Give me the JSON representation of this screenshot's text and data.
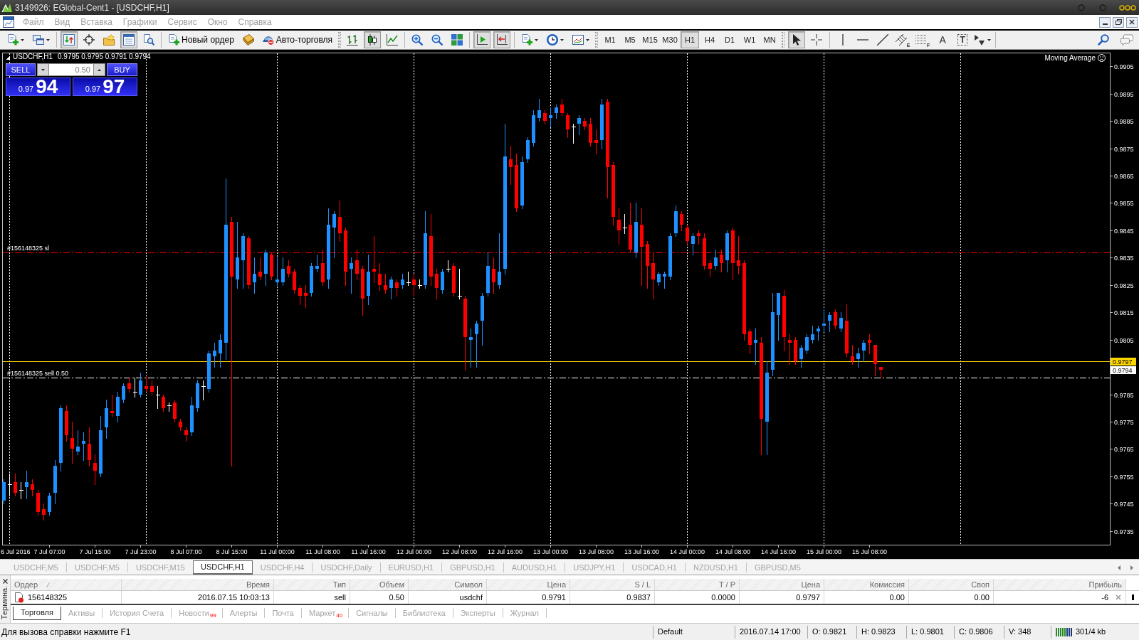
{
  "window": {
    "title": "3149926: EGlobal-Cent1 - [USDCHF,H1]"
  },
  "menu": [
    "Файл",
    "Вид",
    "Вставка",
    "Графики",
    "Сервис",
    "Окно",
    "Справка"
  ],
  "toolbar": {
    "groups": [
      [
        {
          "kind": "newchart",
          "pressed": false
        },
        {
          "kind": "profiles",
          "pressed": false
        }
      ],
      [
        {
          "kind": "market",
          "pressed": true
        },
        {
          "kind": "navigator",
          "pressed": false
        },
        {
          "kind": "favorites",
          "pressed": false
        },
        {
          "kind": "terminal",
          "pressed": true
        },
        {
          "kind": "tester",
          "pressed": false
        }
      ],
      [
        {
          "kind": "order",
          "label": "Новый ордер",
          "pressed": false
        },
        {
          "kind": "editor",
          "pressed": false
        },
        {
          "kind": "autotrade",
          "label": "Авто-торговля",
          "pressed": false
        }
      ],
      [
        {
          "kind": "bars",
          "pressed": false
        },
        {
          "kind": "candles",
          "pressed": true
        },
        {
          "kind": "line",
          "pressed": false
        }
      ],
      [
        {
          "kind": "zoomin",
          "pressed": false
        },
        {
          "kind": "zoomout",
          "pressed": false
        },
        {
          "kind": "tile",
          "pressed": false
        }
      ],
      [
        {
          "kind": "autoscroll",
          "pressed": true
        },
        {
          "kind": "shift",
          "pressed": true
        }
      ],
      [
        {
          "kind": "indicators",
          "pressed": false
        },
        {
          "kind": "periods",
          "pressed": false
        },
        {
          "kind": "templates",
          "pressed": false
        }
      ]
    ],
    "timeframes": [
      {
        "label": "M1",
        "selected": false
      },
      {
        "label": "M5",
        "selected": false
      },
      {
        "label": "M15",
        "selected": false
      },
      {
        "label": "M30",
        "selected": false
      },
      {
        "label": "H1",
        "selected": true
      },
      {
        "label": "H4",
        "selected": false
      },
      {
        "label": "D1",
        "selected": false
      },
      {
        "label": "W1",
        "selected": false
      },
      {
        "label": "MN",
        "selected": false
      }
    ],
    "tools": [
      [
        {
          "kind": "cursor",
          "pressed": true
        },
        {
          "kind": "crosshair",
          "pressed": false
        }
      ],
      [
        {
          "kind": "vline",
          "pressed": false
        },
        {
          "kind": "hline",
          "pressed": false
        },
        {
          "kind": "trend",
          "pressed": false
        },
        {
          "kind": "channel",
          "label": "E",
          "pressed": false
        },
        {
          "kind": "fibo",
          "label": "F",
          "pressed": false
        },
        {
          "kind": "text",
          "label": "A",
          "pressed": false
        },
        {
          "kind": "textlabel",
          "label": "T",
          "pressed": false
        },
        {
          "kind": "arrows",
          "pressed": false
        }
      ]
    ],
    "right": [
      {
        "kind": "search"
      },
      {
        "kind": "chat"
      }
    ]
  },
  "chart": {
    "trade_panel": {
      "sell": {
        "label": "SELL",
        "price_prefix": "0.97",
        "price_big": "94"
      },
      "buy": {
        "label": "BUY",
        "price_prefix": "0.97",
        "price_big": "97"
      },
      "volume": "0.50"
    },
    "expert": {
      "name": "Moving Average",
      "active": false
    },
    "bid_label": "0.9794",
    "chart_data": [
      {
        "type": "candlestick",
        "title": "USDCHF,H1",
        "subtitle": "0.9795 0.9795 0.9791 0.9794",
        "annotations": [
          "6 Jul 2016"
        ],
        "categories": [
          null,
          null,
          null,
          null,
          null,
          null,
          null,
          null,
          "7 Jul 07:00",
          null,
          null,
          null,
          null,
          null,
          null,
          null,
          "7 Jul 15:00",
          null,
          null,
          null,
          null,
          null,
          null,
          null,
          "7 Jul 23:00",
          null,
          null,
          null,
          null,
          null,
          null,
          null,
          "8 Jul 07:00",
          null,
          null,
          null,
          null,
          null,
          null,
          null,
          "8 Jul 15:00",
          null,
          null,
          null,
          null,
          null,
          null,
          null,
          "11 Jul 00:00",
          null,
          null,
          null,
          null,
          null,
          null,
          null,
          "11 Jul 08:00",
          null,
          null,
          null,
          null,
          null,
          null,
          null,
          "11 Jul 16:00",
          null,
          null,
          null,
          null,
          null,
          null,
          null,
          "12 Jul 00:00",
          null,
          null,
          null,
          null,
          null,
          null,
          null,
          "12 Jul 08:00",
          null,
          null,
          null,
          null,
          null,
          null,
          null,
          "12 Jul 16:00",
          null,
          null,
          null,
          null,
          null,
          null,
          null,
          "13 Jul 00:00",
          null,
          null,
          null,
          null,
          null,
          null,
          null,
          "13 Jul 08:00",
          null,
          null,
          null,
          null,
          null,
          null,
          null,
          "13 Jul 16:00",
          null,
          null,
          null,
          null,
          null,
          null,
          null,
          "14 Jul 00:00",
          null,
          null,
          null,
          null,
          null,
          null,
          null,
          "14 Jul 08:00",
          null,
          null,
          null,
          null,
          null,
          null,
          null,
          "14 Jul 16:00",
          null,
          null,
          null,
          null,
          null,
          null,
          null,
          "15 Jul 00:00",
          null,
          null,
          null,
          null,
          null,
          null,
          null,
          "15 Jul 08:00",
          null,
          null,
          null,
          null,
          null,
          null,
          null,
          null,
          null,
          null,
          null,
          null,
          null,
          null,
          null,
          null,
          null,
          null,
          null,
          null,
          null,
          null,
          null,
          null,
          null,
          null,
          null,
          null,
          null,
          null,
          null,
          null,
          null,
          null,
          null,
          null,
          null,
          null,
          null,
          null,
          null,
          null
        ],
        "ohlc": [
          [
            0.9746,
            0.9754,
            0.9745,
            0.9753
          ],
          [
            0.9752,
            0.9756,
            0.9748,
            0.9752
          ],
          [
            0.9753,
            0.9756,
            0.9748,
            0.9749
          ],
          [
            0.975,
            0.9753,
            0.9747,
            0.975
          ],
          [
            0.9751,
            0.9757,
            0.9747,
            0.9753
          ],
          [
            0.9752,
            0.9754,
            0.9748,
            0.975
          ],
          [
            0.9749,
            0.975,
            0.9741,
            0.9742
          ],
          [
            0.9743,
            0.9745,
            0.9739,
            0.9741
          ],
          [
            0.9742,
            0.9749,
            0.9741,
            0.9748
          ],
          [
            0.9749,
            0.9761,
            0.9745,
            0.9759
          ],
          [
            0.976,
            0.9781,
            0.9757,
            0.978
          ],
          [
            0.9779,
            0.9781,
            0.9768,
            0.977
          ],
          [
            0.9769,
            0.9775,
            0.976,
            0.9765
          ],
          [
            0.9764,
            0.9772,
            0.9763,
            0.9766
          ],
          [
            0.9767,
            0.9771,
            0.9761,
            0.9768
          ],
          [
            0.9767,
            0.9773,
            0.9759,
            0.9761
          ],
          [
            0.976,
            0.9763,
            0.9752,
            0.9757
          ],
          [
            0.9756,
            0.9777,
            0.9755,
            0.9772
          ],
          [
            0.9773,
            0.9783,
            0.9769,
            0.978
          ],
          [
            0.9779,
            0.9785,
            0.9777,
            0.9778
          ],
          [
            0.9777,
            0.9786,
            0.9775,
            0.9784
          ],
          [
            0.9783,
            0.9789,
            0.9782,
            0.9788
          ],
          [
            0.9789,
            0.9791,
            0.9786,
            0.9787
          ],
          [
            0.9786,
            0.9791,
            0.9784,
            0.9786
          ],
          [
            0.9785,
            0.9793,
            0.9784,
            0.979
          ],
          [
            0.9788,
            0.9792,
            0.9786,
            0.9787
          ],
          [
            0.9788,
            0.979,
            0.9785,
            0.9786
          ],
          [
            0.9785,
            0.9788,
            0.978,
            0.9785
          ],
          [
            0.9784,
            0.9785,
            0.9779,
            0.978
          ],
          [
            0.9781,
            0.9782,
            0.9779,
            0.9781
          ],
          [
            0.9782,
            0.9783,
            0.9775,
            0.9776
          ],
          [
            0.9775,
            0.9776,
            0.9772,
            0.9773
          ],
          [
            0.9772,
            0.9773,
            0.9768,
            0.977
          ],
          [
            0.9771,
            0.9784,
            0.977,
            0.9781
          ],
          [
            0.978,
            0.979,
            0.9779,
            0.9789
          ],
          [
            0.9788,
            0.979,
            0.9783,
            0.9788
          ],
          [
            0.9787,
            0.9801,
            0.9786,
            0.98
          ],
          [
            0.9799,
            0.9804,
            0.9795,
            0.9801
          ],
          [
            0.98,
            0.9807,
            0.9795,
            0.9805
          ],
          [
            0.9804,
            0.9864,
            0.9798,
            0.9847
          ],
          [
            0.9848,
            0.985,
            0.9759,
            0.9828
          ],
          [
            0.9827,
            0.9848,
            0.9824,
            0.9835
          ],
          [
            0.9834,
            0.9844,
            0.9824,
            0.9843
          ],
          [
            0.9842,
            0.9843,
            0.9824,
            0.9825
          ],
          [
            0.9826,
            0.9835,
            0.9822,
            0.9829
          ],
          [
            0.983,
            0.9835,
            0.9827,
            0.9828
          ],
          [
            0.9829,
            0.9838,
            0.9825,
            0.9837
          ],
          [
            0.9836,
            0.9837,
            0.9827,
            0.9828
          ],
          [
            0.9826,
            0.9835,
            0.9825,
            0.9827
          ],
          [
            0.9826,
            0.9835,
            0.9825,
            0.9831
          ],
          [
            0.9832,
            0.9834,
            0.9828,
            0.9829
          ],
          [
            0.983,
            0.9831,
            0.9822,
            0.9823
          ],
          [
            0.9824,
            0.9825,
            0.9818,
            0.9821
          ],
          [
            0.9822,
            0.9825,
            0.9817,
            0.9821
          ],
          [
            0.9822,
            0.9833,
            0.9821,
            0.9832
          ],
          [
            0.9831,
            0.9836,
            0.983,
            0.9832
          ],
          [
            0.9833,
            0.9838,
            0.9825,
            0.9826
          ],
          [
            0.9827,
            0.9853,
            0.9824,
            0.9847
          ],
          [
            0.9846,
            0.9852,
            0.9835,
            0.9851
          ],
          [
            0.985,
            0.9856,
            0.9841,
            0.9844
          ],
          [
            0.9845,
            0.9846,
            0.9825,
            0.983
          ],
          [
            0.9831,
            0.9835,
            0.9822,
            0.9833
          ],
          [
            0.9834,
            0.9838,
            0.9827,
            0.9829
          ],
          [
            0.9831,
            0.9832,
            0.9814,
            0.982
          ],
          [
            0.9821,
            0.9836,
            0.9818,
            0.983
          ],
          [
            0.9831,
            0.9843,
            0.9826,
            0.983
          ],
          [
            0.9829,
            0.9833,
            0.9823,
            0.9825
          ],
          [
            0.9825,
            0.9829,
            0.9822,
            0.9823
          ],
          [
            0.9824,
            0.9828,
            0.982,
            0.9827
          ],
          [
            0.9826,
            0.9827,
            0.9821,
            0.9824
          ],
          [
            0.9825,
            0.9829,
            0.9824,
            0.9827
          ],
          [
            0.9826,
            0.983,
            0.9825,
            0.9826
          ],
          [
            0.9827,
            0.9829,
            0.9821,
            0.9825
          ],
          [
            0.9825,
            0.9827,
            0.9824,
            0.9825
          ],
          [
            0.9825,
            0.9852,
            0.9824,
            0.9844
          ],
          [
            0.9843,
            0.9851,
            0.9825,
            0.9828
          ],
          [
            0.9829,
            0.9831,
            0.982,
            0.9824
          ],
          [
            0.9823,
            0.9831,
            0.9822,
            0.983
          ],
          [
            0.9831,
            0.9834,
            0.983,
            0.9831
          ],
          [
            0.9832,
            0.9833,
            0.9821,
            0.9822
          ],
          [
            0.9821,
            0.9831,
            0.982,
            0.9821
          ],
          [
            0.982,
            0.9821,
            0.9794,
            0.9806
          ],
          [
            0.9805,
            0.9809,
            0.9795,
            0.9806
          ],
          [
            0.9807,
            0.9812,
            0.9795,
            0.9811
          ],
          [
            0.9812,
            0.9822,
            0.9803,
            0.9821
          ],
          [
            0.9822,
            0.9837,
            0.9821,
            0.9832
          ],
          [
            0.9831,
            0.9835,
            0.9822,
            0.9826
          ],
          [
            0.9825,
            0.9844,
            0.9824,
            0.983
          ],
          [
            0.9831,
            0.9884,
            0.9829,
            0.9872
          ],
          [
            0.9871,
            0.9876,
            0.9862,
            0.9868
          ],
          [
            0.9869,
            0.9873,
            0.9852,
            0.9853
          ],
          [
            0.9854,
            0.9872,
            0.9853,
            0.987
          ],
          [
            0.9871,
            0.9879,
            0.987,
            0.9878
          ],
          [
            0.9877,
            0.9889,
            0.9876,
            0.9887
          ],
          [
            0.9886,
            0.9893,
            0.9885,
            0.9889
          ],
          [
            0.9888,
            0.9889,
            0.9884,
            0.9885
          ],
          [
            0.9886,
            0.989,
            0.9883,
            0.9887
          ],
          [
            0.9888,
            0.9891,
            0.9886,
            0.989
          ],
          [
            0.9891,
            0.9893,
            0.9887,
            0.9888
          ],
          [
            0.9887,
            0.9888,
            0.9879,
            0.9882
          ],
          [
            0.9883,
            0.9884,
            0.9877,
            0.9883
          ],
          [
            0.9884,
            0.9887,
            0.988,
            0.9886
          ],
          [
            0.9885,
            0.9886,
            0.9882,
            0.9883
          ],
          [
            0.9884,
            0.9886,
            0.9876,
            0.9877
          ],
          [
            0.9878,
            0.9882,
            0.9873,
            0.9877
          ],
          [
            0.9878,
            0.9893,
            0.9875,
            0.9891
          ],
          [
            0.9892,
            0.9893,
            0.9857,
            0.9868
          ],
          [
            0.9869,
            0.987,
            0.9847,
            0.985
          ],
          [
            0.9849,
            0.9853,
            0.984,
            0.9845
          ],
          [
            0.9846,
            0.9851,
            0.9844,
            0.9846
          ],
          [
            0.9847,
            0.9855,
            0.9837,
            0.9838
          ],
          [
            0.9837,
            0.9855,
            0.9835,
            0.9848
          ],
          [
            0.9847,
            0.9853,
            0.9825,
            0.9839
          ],
          [
            0.984,
            0.9841,
            0.9824,
            0.9832
          ],
          [
            0.9833,
            0.9837,
            0.982,
            0.9827
          ],
          [
            0.9826,
            0.983,
            0.9825,
            0.9829
          ],
          [
            0.9828,
            0.983,
            0.9824,
            0.9829
          ],
          [
            0.9828,
            0.9844,
            0.9827,
            0.9843
          ],
          [
            0.9844,
            0.9854,
            0.9843,
            0.9852
          ],
          [
            0.9851,
            0.9852,
            0.9845,
            0.9847
          ],
          [
            0.9846,
            0.9847,
            0.984,
            0.9841
          ],
          [
            0.984,
            0.9844,
            0.9836,
            0.9843
          ],
          [
            0.9844,
            0.9845,
            0.984,
            0.9843
          ],
          [
            0.9842,
            0.9844,
            0.9831,
            0.9832
          ],
          [
            0.9833,
            0.9834,
            0.9828,
            0.9831
          ],
          [
            0.9832,
            0.9838,
            0.9831,
            0.9835
          ],
          [
            0.9836,
            0.9838,
            0.983,
            0.9833
          ],
          [
            0.9834,
            0.9845,
            0.983,
            0.9844
          ],
          [
            0.9845,
            0.9846,
            0.9827,
            0.9833
          ],
          [
            0.9834,
            0.9843,
            0.9829,
            0.9832
          ],
          [
            0.9833,
            0.9834,
            0.9805,
            0.9807
          ],
          [
            0.9808,
            0.9809,
            0.98,
            0.9803
          ],
          [
            0.9804,
            0.9809,
            0.9796,
            0.9805
          ],
          [
            0.9804,
            0.9806,
            0.9763,
            0.9776
          ],
          [
            0.9775,
            0.9797,
            0.9763,
            0.9793
          ],
          [
            0.9794,
            0.9822,
            0.9792,
            0.9815
          ],
          [
            0.9814,
            0.9822,
            0.9805,
            0.9822
          ],
          [
            0.9821,
            0.9823,
            0.9801,
            0.9806
          ],
          [
            0.9805,
            0.9807,
            0.9796,
            0.9804
          ],
          [
            0.9805,
            0.9806,
            0.9796,
            0.9797
          ],
          [
            0.9798,
            0.9803,
            0.9795,
            0.9802
          ],
          [
            0.9801,
            0.9807,
            0.98,
            0.9806
          ],
          [
            0.9805,
            0.981,
            0.9804,
            0.9807
          ],
          [
            0.9808,
            0.981,
            0.9805,
            0.9809
          ],
          [
            0.981,
            0.9816,
            0.9808,
            0.9811
          ],
          [
            0.9812,
            0.9815,
            0.9808,
            0.9814
          ],
          [
            0.9815,
            0.9816,
            0.9809,
            0.981
          ],
          [
            0.9809,
            0.9815,
            0.9808,
            0.9813
          ],
          [
            0.9812,
            0.9818,
            0.9799,
            0.98
          ],
          [
            0.9799,
            0.9803,
            0.9796,
            0.9797
          ],
          [
            0.9798,
            0.9802,
            0.9795,
            0.98
          ],
          [
            0.9801,
            0.9805,
            0.9797,
            0.9804
          ],
          [
            0.9805,
            0.9807,
            0.98,
            0.9804
          ],
          [
            0.9803,
            0.9803,
            0.9792,
            0.9796
          ],
          [
            0.9795,
            0.9795,
            0.9791,
            0.9794
          ],
          null,
          null,
          null,
          null,
          null,
          null,
          null,
          null,
          null,
          null,
          null,
          null,
          null,
          null,
          null,
          null,
          null,
          null,
          null,
          null,
          null,
          null,
          null,
          null,
          null,
          null,
          null,
          null,
          null,
          null,
          null,
          null,
          null,
          null,
          null,
          null,
          null,
          null,
          null,
          null
        ],
        "ylim": [
          0.973,
          0.991
        ],
        "yticks": [
          0.9735,
          0.9745,
          0.9755,
          0.9765,
          0.9775,
          0.9785,
          0.9805,
          0.9815,
          0.9825,
          0.9835,
          0.9845,
          0.9855,
          0.9865,
          0.9875,
          0.9885,
          0.9895,
          0.9905
        ],
        "ref_lines": [
          {
            "axis": "y",
            "value": 0.9837,
            "label": "#156148325 sl",
            "color": "#ff0000",
            "line_style": "dashdot"
          },
          {
            "axis": "y",
            "value": 0.9791,
            "label": "#156148325 sell 0.50",
            "color": "#ffffff",
            "line_style": "dashdot"
          },
          {
            "axis": "y",
            "value": 0.9797,
            "label": "0.9797",
            "color": "#ffd700",
            "line_style": "solid"
          }
        ]
      }
    ]
  },
  "chart_tabs": [
    {
      "label": "USDCHF,M5",
      "selected": false
    },
    {
      "label": "USDCHF,M5",
      "selected": false
    },
    {
      "label": "USDCHF,M15",
      "selected": false
    },
    {
      "label": "USDCHF,H1",
      "selected": true
    },
    {
      "label": "USDCHF,H4",
      "selected": false
    },
    {
      "label": "USDCHF,Daily",
      "selected": false
    },
    {
      "label": "EURUSD,H1",
      "selected": false
    },
    {
      "label": "GBPUSD,H1",
      "selected": false
    },
    {
      "label": "AUDUSD,H1",
      "selected": false
    },
    {
      "label": "USDJPY,H1",
      "selected": false
    },
    {
      "label": "USDCAD,H1",
      "selected": false
    },
    {
      "label": "NZDUSD,H1",
      "selected": false
    },
    {
      "label": "GBPUSD,M5",
      "selected": false
    }
  ],
  "terminal": {
    "title": "Термина.",
    "columns": [
      {
        "label": "Ордер",
        "sorted": true
      },
      {
        "label": "Время",
        "sorted": false
      },
      {
        "label": "Тип",
        "sorted": false
      },
      {
        "label": "Объем",
        "sorted": false
      },
      {
        "label": "Символ",
        "sorted": false
      },
      {
        "label": "Цена",
        "sorted": false
      },
      {
        "label": "S / L",
        "sorted": false
      },
      {
        "label": "T / P",
        "sorted": false
      },
      {
        "label": "Цена",
        "sorted": false
      },
      {
        "label": "Комиссия",
        "sorted": false
      },
      {
        "label": "Своп",
        "sorted": false
      },
      {
        "label": "Прибыль",
        "sorted": false
      }
    ],
    "rows": [
      {
        "cells": [
          "156148325",
          "2016.07.15 10:03:13",
          "sell",
          "0.50",
          "usdchf",
          "0.9791",
          "0.9837",
          "0.0000",
          "0.9797",
          "0.00",
          "0.00",
          "-6"
        ]
      }
    ],
    "tabs": [
      {
        "label": "Торговля",
        "selected": true
      },
      {
        "label": "Активы",
        "selected": false
      },
      {
        "label": "История Счета",
        "selected": false
      },
      {
        "label": "Новости",
        "selected": false,
        "badge": "99"
      },
      {
        "label": "Алерты",
        "selected": false
      },
      {
        "label": "Почта",
        "selected": false
      },
      {
        "label": "Маркет",
        "selected": false,
        "badge": "40"
      },
      {
        "label": "Сигналы",
        "selected": false
      },
      {
        "label": "Библиотека",
        "selected": false
      },
      {
        "label": "Эксперты",
        "selected": false
      },
      {
        "label": "Журнал",
        "selected": false
      }
    ]
  },
  "status_bar": {
    "help": "Для вызова справки нажмите F1",
    "profile": "Default",
    "bar_time": "2016.07.14 17:00",
    "open": "O: 0.9821",
    "high": "H: 0.9823",
    "low": "L: 0.9801",
    "close": "C: 0.9806",
    "volume": "V: 348",
    "traffic": "301/4 kb"
  }
}
